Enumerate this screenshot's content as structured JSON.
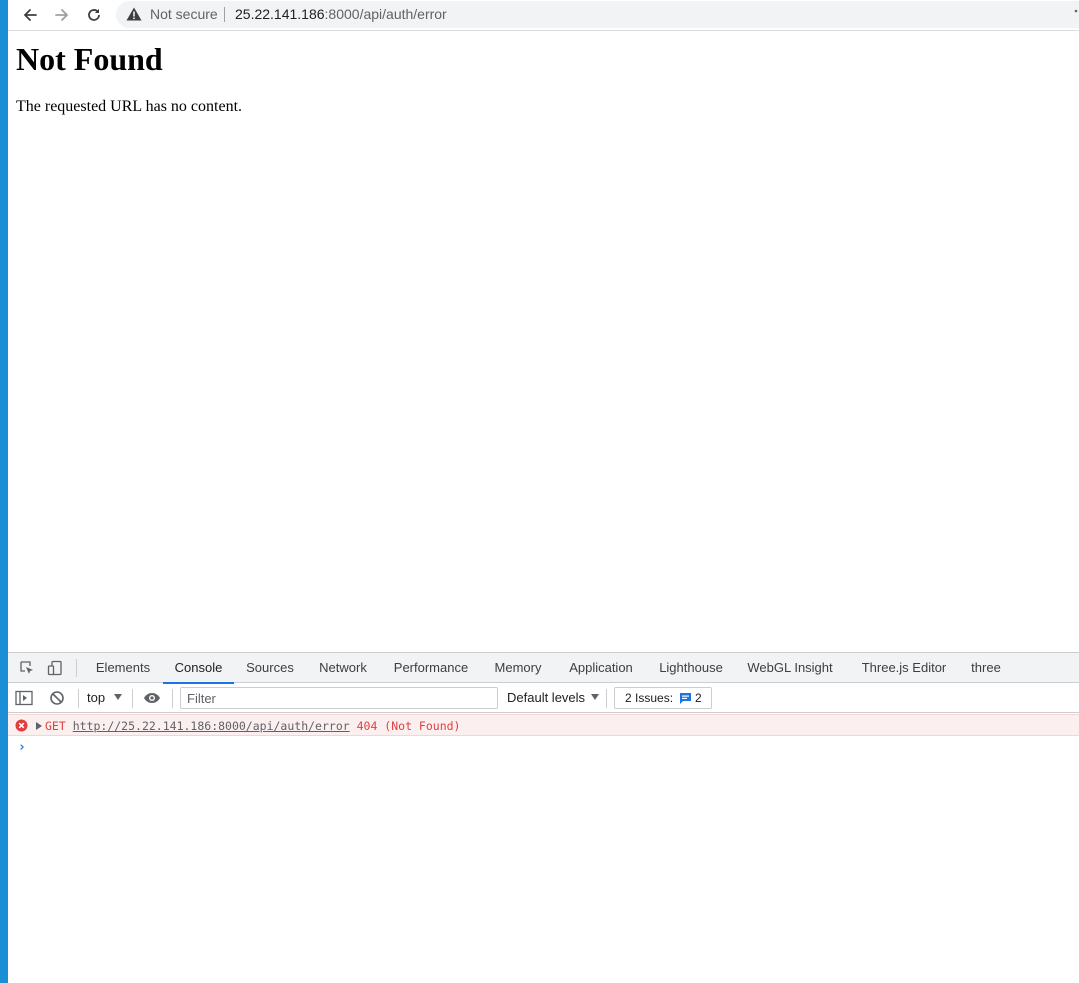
{
  "browser": {
    "security_label": "Not secure",
    "url_host": "25.22.141.186",
    "url_rest": ":8000/api/auth/error",
    "icons": [
      "back-arrow-icon",
      "forward-arrow-icon",
      "reload-icon",
      "warning-icon",
      "menu-dots-icon"
    ]
  },
  "page": {
    "heading": "Not Found",
    "body": "The requested URL has no content."
  },
  "devtools": {
    "tabs": [
      {
        "label": "Elements",
        "active": false
      },
      {
        "label": "Console",
        "active": true
      },
      {
        "label": "Sources",
        "active": false
      },
      {
        "label": "Network",
        "active": false
      },
      {
        "label": "Performance",
        "active": false
      },
      {
        "label": "Memory",
        "active": false
      },
      {
        "label": "Application",
        "active": false
      },
      {
        "label": "Lighthouse",
        "active": false
      },
      {
        "label": "WebGL Insight",
        "active": false
      },
      {
        "label": "Three.js Editor",
        "active": false
      },
      {
        "label": "three",
        "active": false
      }
    ],
    "console_bar": {
      "context": "top",
      "filter_placeholder": "Filter",
      "levels": "Default levels",
      "issues_label": "2 Issues:",
      "issues_count": "2"
    },
    "log": {
      "method": "GET",
      "url": "http://25.22.141.186:8000/api/auth/error",
      "status": "404 (Not Found)"
    },
    "prompt": "›",
    "accent_color": "#1a73e8",
    "error_color": "#e23e3e"
  }
}
